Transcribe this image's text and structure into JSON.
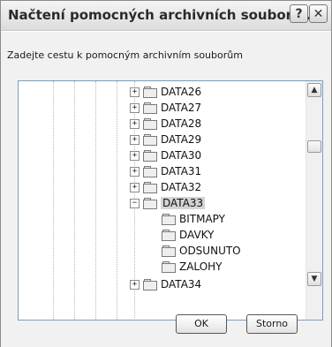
{
  "window": {
    "title": "Načtení pomocných archivních souborů ...",
    "help_glyph": "?",
    "close_glyph": "✕"
  },
  "prompt": "Zadejte cestu k pomocným archivním souborům",
  "tree": {
    "collapsed_glyph": "+",
    "expanded_glyph": "−",
    "nodes": [
      {
        "label": "DATA26",
        "state": "collapsed"
      },
      {
        "label": "DATA27",
        "state": "collapsed"
      },
      {
        "label": "DATA28",
        "state": "collapsed"
      },
      {
        "label": "DATA29",
        "state": "collapsed"
      },
      {
        "label": "DATA30",
        "state": "collapsed"
      },
      {
        "label": "DATA31",
        "state": "collapsed"
      },
      {
        "label": "DATA32",
        "state": "collapsed"
      },
      {
        "label": "DATA33",
        "state": "expanded",
        "selected": true
      },
      {
        "label": "BITMAPY",
        "state": "leaf"
      },
      {
        "label": "DAVKY",
        "state": "leaf"
      },
      {
        "label": "ODSUNUTO",
        "state": "leaf"
      },
      {
        "label": "ZALOHY",
        "state": "leaf"
      },
      {
        "label": "DATA34",
        "state": "collapsed"
      }
    ]
  },
  "scrollbar": {
    "up_glyph": "▲",
    "down_glyph": "▼"
  },
  "buttons": {
    "ok": "OK",
    "cancel": "Storno"
  }
}
